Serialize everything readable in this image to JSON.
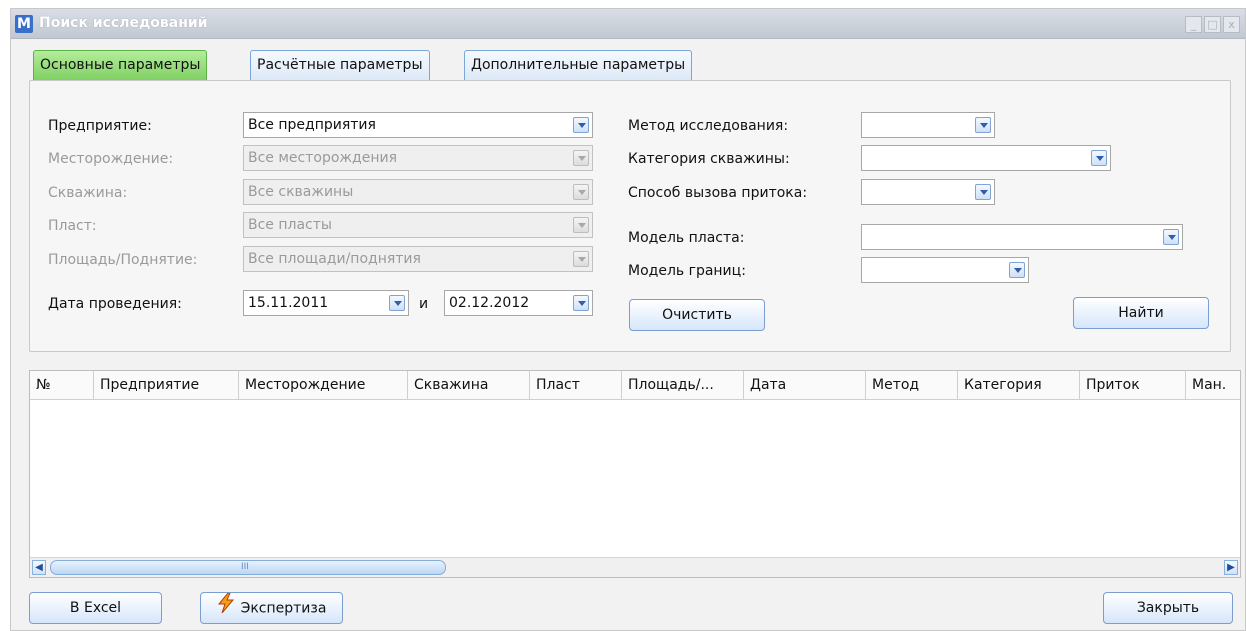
{
  "window": {
    "logo": "M",
    "title": "Поиск исследований",
    "controls": {
      "minimize": "_",
      "maximize": "□",
      "close": "x"
    }
  },
  "tabs": [
    {
      "label": "Основные параметры",
      "active": true
    },
    {
      "label": "Расчётные параметры",
      "active": false
    },
    {
      "label": "Дополнительные параметры",
      "active": false
    }
  ],
  "form": {
    "enterprise": {
      "label": "Предприятие:",
      "value": "Все предприятия"
    },
    "field": {
      "label": "Месторождение:",
      "value": "Все месторождения"
    },
    "well": {
      "label": "Скважина:",
      "value": "Все скважины"
    },
    "layer": {
      "label": "Пласт:",
      "value": "Все пласты"
    },
    "area": {
      "label": "Площадь/Поднятие:",
      "value": "Все площади/поднятия"
    },
    "date": {
      "label": "Дата проведения:",
      "from": "15.11.2011",
      "conj": "и",
      "to": "02.12.2012"
    },
    "method": {
      "label": "Метод исследования:",
      "value": ""
    },
    "category": {
      "label": "Категория скважины:",
      "value": ""
    },
    "inflow": {
      "label": "Способ вызова притока:",
      "value": ""
    },
    "layer_model": {
      "label": "Модель пласта:",
      "value": ""
    },
    "boundary_model": {
      "label": "Модель границ:",
      "value": ""
    },
    "clear_button": "Очистить",
    "find_button": "Найти"
  },
  "table": {
    "columns": [
      "№",
      "Предприятие",
      "Месторождение",
      "Скважина",
      "Пласт",
      "Площадь/...",
      "Дата",
      "Метод",
      "Категория",
      "Приток",
      "Ман."
    ],
    "scroll_grip": "III"
  },
  "footer": {
    "excel_button": "В Excel",
    "expertise_button": "Экспертиза",
    "close_button": "Закрыть"
  },
  "colors": {
    "active_tab": "#7fd163",
    "accent": "#2f5fa8",
    "bolt": "#f2a20c"
  }
}
